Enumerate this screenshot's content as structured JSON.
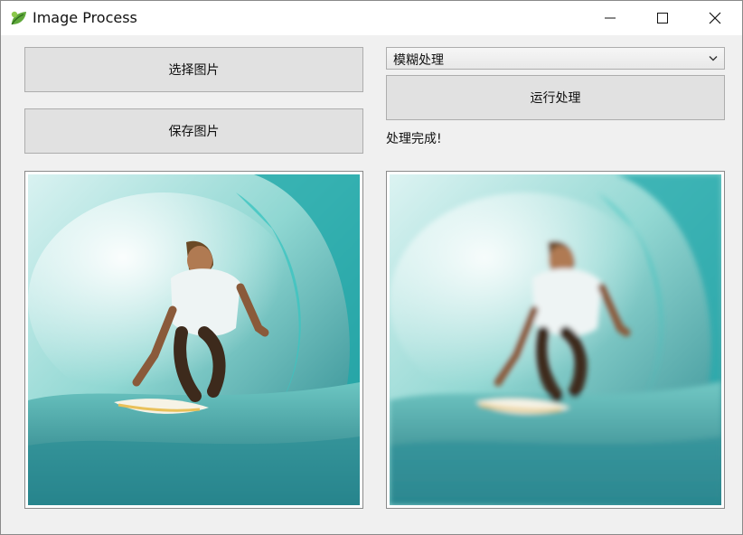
{
  "window": {
    "title": "Image Process",
    "controls": [
      "minimize-icon",
      "maximize-icon",
      "close-icon"
    ]
  },
  "toolbar": {
    "select_image_label": "选择图片",
    "save_image_label": "保存图片",
    "run_label": "运行处理"
  },
  "filter": {
    "selected": "模糊处理"
  },
  "status": {
    "text": "处理完成!"
  },
  "images": {
    "original": "surfer-wave-photo",
    "processed": "surfer-wave-photo-blurred"
  },
  "colors": {
    "wave_teal": "#2bb5b3",
    "button_bg": "#e1e1e1",
    "window_bg": "#f0f0f0"
  }
}
